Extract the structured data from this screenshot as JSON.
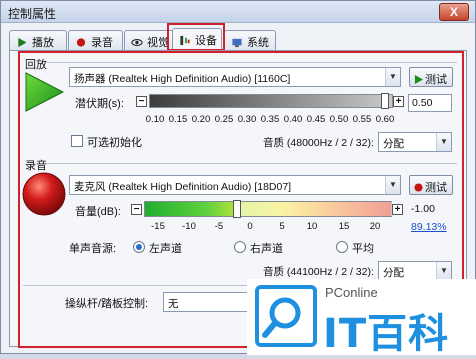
{
  "window": {
    "title": "控制属性",
    "close": "X"
  },
  "tabs": [
    {
      "label": "播放",
      "icon": "play-icon"
    },
    {
      "label": "录音",
      "icon": "record-dot-icon"
    },
    {
      "label": "视觉",
      "icon": "eye-icon"
    },
    {
      "label": "设备",
      "icon": "device-icon"
    },
    {
      "label": "系统",
      "icon": "system-icon"
    }
  ],
  "playback": {
    "group_label": "回放",
    "device": "扬声器 (Realtek High Definition Audio) [1160C]",
    "test_button": "测试",
    "latency_label": "潜伏期(s):",
    "latency_value": "0.50",
    "latency_ticks": [
      "0.10",
      "0.15",
      "0.20",
      "0.25",
      "0.30",
      "0.35",
      "0.40",
      "0.45",
      "0.50",
      "0.55",
      "0.60"
    ],
    "optional_init": "可选初始化",
    "quality_label": "音质 (48000Hz / 2 / 32):",
    "quality_value": "分配"
  },
  "recording": {
    "group_label": "录音",
    "device": "麦克风 (Realtek High Definition Audio) [18D07]",
    "test_button": "测试",
    "volume_label": "音量(dB):",
    "volume_value": "-1.00",
    "volume_percent": "89.13%",
    "volume_ticks": [
      "-15",
      "-10",
      "-5",
      "0",
      "5",
      "10",
      "15",
      "20"
    ],
    "mono_label": "单声音源:",
    "mono_options": [
      "左声道",
      "右声道",
      "平均"
    ],
    "mono_selected": 0,
    "quality_label": "音质 (44100Hz / 2 / 32):",
    "quality_value": "分配"
  },
  "joystick": {
    "label": "操纵杆/踏板控制:",
    "value": "无"
  },
  "watermark": {
    "brand": "PConline",
    "name": "IT百科"
  },
  "colors": {
    "accent_red": "#d0212c",
    "play_green": "#2aa32a",
    "record_red": "#c41414",
    "logo_blue": "#1f8fe0"
  }
}
